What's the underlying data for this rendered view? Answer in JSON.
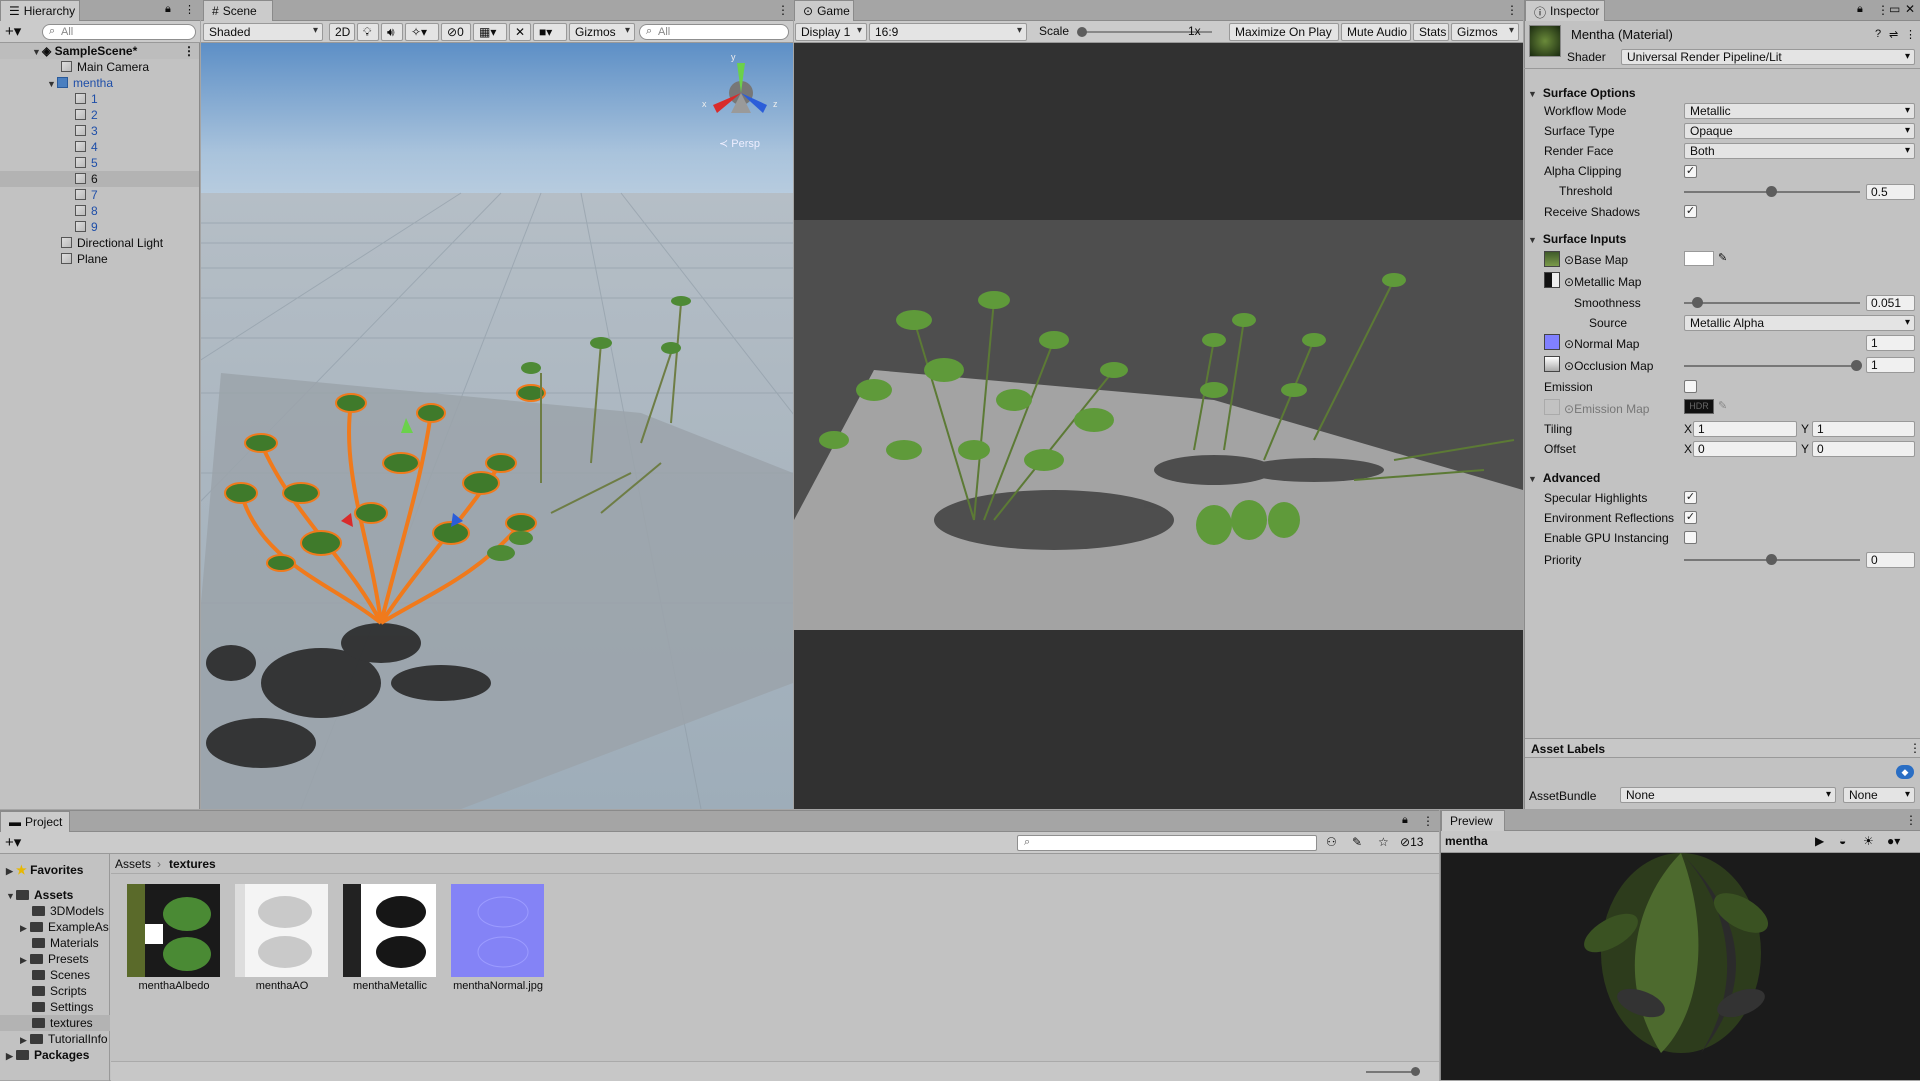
{
  "hierarchy": {
    "tab": "Hierarchy",
    "search_placeholder": "All",
    "scene_name": "SampleScene*",
    "items": [
      "Main Camera",
      "mentha",
      "1",
      "2",
      "3",
      "4",
      "5",
      "6",
      "7",
      "8",
      "9",
      "Directional Light",
      "Plane"
    ]
  },
  "scene": {
    "tab": "Scene",
    "shading": "Shaded",
    "mode_2d": "2D",
    "hidden_count": "0",
    "gizmos": "Gizmos",
    "search_placeholder": "All",
    "persp": "Persp",
    "axis_x": "x",
    "axis_y": "y",
    "axis_z": "z"
  },
  "game": {
    "tab": "Game",
    "display": "Display 1",
    "aspect": "16:9",
    "scale_label": "Scale",
    "scale_value": "1x",
    "maximize": "Maximize On Play",
    "mute": "Mute Audio",
    "stats": "Stats",
    "gizmos": "Gizmos"
  },
  "inspector": {
    "tab": "Inspector",
    "title": "Mentha (Material)",
    "shader_label": "Shader",
    "shader_value": "Universal Render Pipeline/Lit",
    "surface_options": "Surface Options",
    "workflow_label": "Workflow Mode",
    "workflow_value": "Metallic",
    "surface_type_label": "Surface Type",
    "surface_type_value": "Opaque",
    "render_face_label": "Render Face",
    "render_face_value": "Both",
    "alpha_clip_label": "Alpha Clipping",
    "alpha_clip": true,
    "threshold_label": "Threshold",
    "threshold_value": "0.5",
    "threshold_fraction": 0.5,
    "receive_shadows_label": "Receive Shadows",
    "receive_shadows": true,
    "surface_inputs": "Surface Inputs",
    "base_map_label": "Base Map",
    "metallic_map_label": "Metallic Map",
    "smoothness_label": "Smoothness",
    "smoothness_value": "0.051",
    "smoothness_fraction": 0.051,
    "source_label": "Source",
    "source_value": "Metallic Alpha",
    "normal_map_label": "Normal Map",
    "normal_map_value": "1",
    "occlusion_map_label": "Occlusion Map",
    "occlusion_value": "1",
    "occlusion_fraction": 1,
    "emission_label": "Emission",
    "emission": false,
    "emission_map_label": "Emission Map",
    "hdr_label": "HDR",
    "tiling_label": "Tiling",
    "tiling_x": "1",
    "tiling_y": "1",
    "offset_label": "Offset",
    "offset_x": "0",
    "offset_y": "0",
    "x_label": "X",
    "y_label": "Y",
    "advanced": "Advanced",
    "spec_label": "Specular Highlights",
    "spec": true,
    "env_label": "Environment Reflections",
    "env": true,
    "gpu_label": "Enable GPU Instancing",
    "gpu": false,
    "priority_label": "Priority",
    "priority_value": "0",
    "priority_fraction": 0.5,
    "asset_labels": "Asset Labels",
    "assetbundle_label": "AssetBundle",
    "assetbundle_value": "None",
    "assetbundle_variant": "None"
  },
  "project": {
    "tab": "Project",
    "favorites": "Favorites",
    "assets": "Assets",
    "folders": [
      "3DModels",
      "ExampleAs",
      "Materials",
      "Presets",
      "Scenes",
      "Scripts",
      "Settings",
      "textures",
      "TutorialInfo"
    ],
    "packages": "Packages",
    "breadcrumb_root": "Assets",
    "breadcrumb_current": "textures",
    "hidden_count": "13",
    "textures": [
      "menthaAlbedo",
      "menthaAO",
      "menthaMetallic",
      "menthaNormal.jpg"
    ]
  },
  "preview": {
    "tab": "Preview",
    "object": "mentha"
  },
  "colors": {
    "selection_blue": "#3a72b0",
    "highlight_orange": "#f07a1c",
    "normal_purple": "#8080ff"
  }
}
